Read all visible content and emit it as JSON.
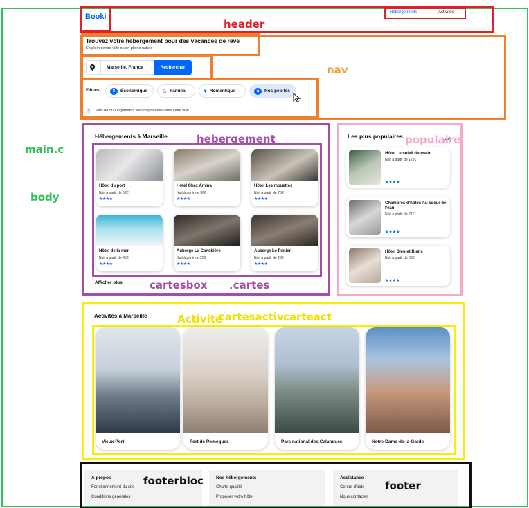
{
  "annotations": {
    "header": "header",
    "nav": "nav",
    "main": "main.c",
    "body": "body",
    "hebergement": "hebergement",
    "populaire": "populaire",
    "cartesbox": "cartesbox",
    "cartes": ".cartes",
    "activite": "Activité",
    "cartesactiv": "cartesactiv",
    "carteact": "carteact",
    "footerbloc": "footerbloc",
    "footer": "footer"
  },
  "header": {
    "logo": "Booki",
    "nav_links": [
      "Hébergements",
      "Activités"
    ]
  },
  "hero": {
    "title": "Trouvez votre hébergement pour des vacances de rêve",
    "subtitle": "En plein centre-ville ou en pleine nature"
  },
  "search": {
    "location": "Marseille, France",
    "button": "Rechercher"
  },
  "filters": {
    "label": "Filtres",
    "items": [
      "Économique",
      "Familial",
      "Romantique",
      "Nos pépites"
    ],
    "info": "Plus de 500 logements sont disponibles dans cette ville"
  },
  "hebergements": {
    "title": "Hébergements à Marseille",
    "cards": [
      {
        "name": "Hôtel du port",
        "price": "Nuit à partir de 52€",
        "stars": "★★★★"
      },
      {
        "name": "Hôtel Chez Amina",
        "price": "Nuit à partir de 96€",
        "stars": "★★★★"
      },
      {
        "name": "Hôtel Les mouettes",
        "price": "Nuit à partir de 76€",
        "stars": "★★★★"
      },
      {
        "name": "Hôtel de la mer",
        "price": "Nuit à partir de 46€",
        "stars": "★★★★"
      },
      {
        "name": "Auberge La Canebière",
        "price": "Nuit à partir de 25€",
        "stars": "★★★★"
      },
      {
        "name": "Auberge Le Panier",
        "price": "Nuit à partir de 23€",
        "stars": "★★★★"
      }
    ],
    "more": "Afficher plus"
  },
  "populaires": {
    "title": "Les plus populaires",
    "items": [
      {
        "name": "Hôtel Le soleil du matin",
        "price": "Nuit à partir de 128€",
        "stars": "★★★★"
      },
      {
        "name": "Chambres d'hôtes Au coeur de l'eau",
        "price": "Nuit à partir de 71€",
        "stars": "★★★★"
      },
      {
        "name": "Hôtel Bleu et Blanc",
        "price": "Nuit à partir de 68€",
        "stars": "★★★★"
      }
    ]
  },
  "activites": {
    "title": "Activités à Marseille",
    "items": [
      "Vieux-Port",
      "Fort de Pomègues",
      "Parc national des Calanques",
      "Notre-Dame-de-la-Garde"
    ]
  },
  "footer": {
    "columns": [
      {
        "title": "À propos",
        "links": [
          "Fonctionnement du site",
          "Conditions générales"
        ]
      },
      {
        "title": "Nos hébergements",
        "links": [
          "Charte qualité",
          "Proposer votre hôtel"
        ]
      },
      {
        "title": "Assistance",
        "links": [
          "Centre d'aide",
          "Nous contacter"
        ]
      }
    ]
  },
  "colors": {
    "brand": "#0065fc",
    "main_outline": "#2ec05a",
    "header_outline": "#e0202a",
    "nav_outline": "#f07f2a",
    "hebergement_outline": "#a44ea8",
    "populaire_outline": "#f5a8c8",
    "activite_outline": "#f7f000",
    "footer_outline": "#111111"
  }
}
